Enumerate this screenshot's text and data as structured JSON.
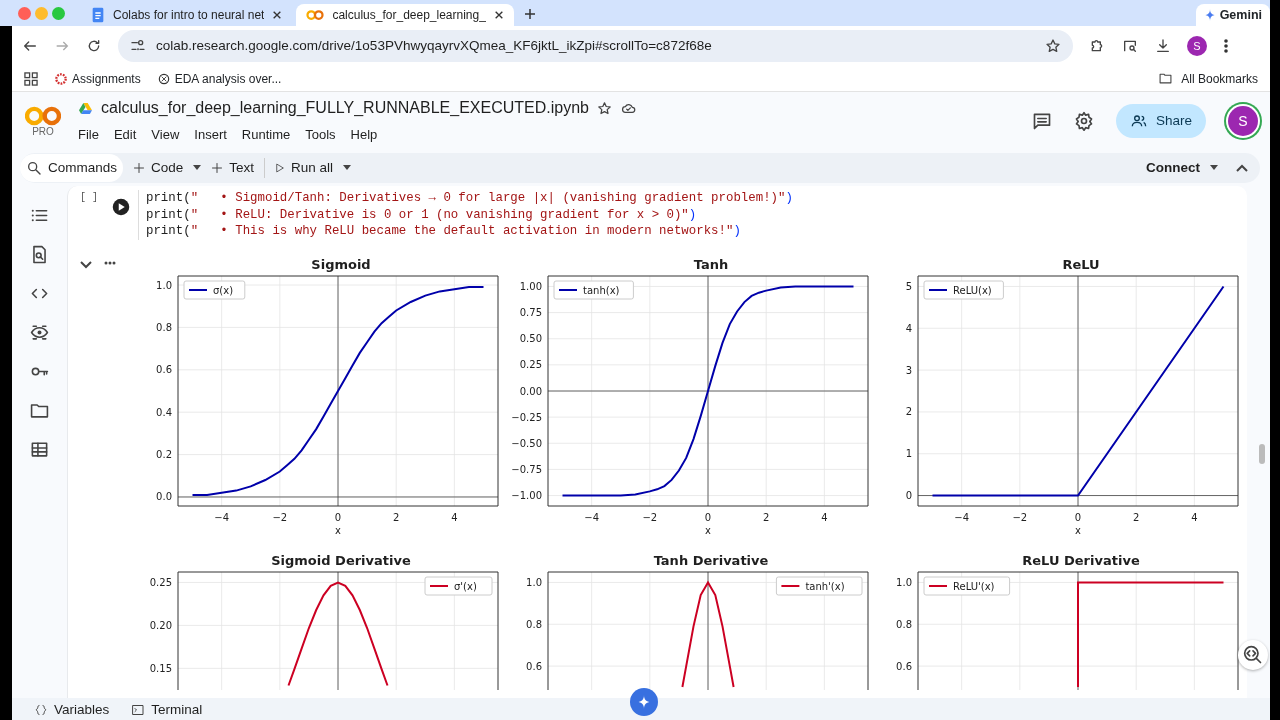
{
  "browser": {
    "tabs": [
      {
        "title": "Colabs for intro to neural net",
        "kind": "doc",
        "selected": false
      },
      {
        "title": "calculus_for_deep_learning_",
        "kind": "colab",
        "selected": true
      }
    ],
    "gemini": "Gemini",
    "address": "colab.research.google.com/drive/1o53PVhwyqayrvXQmea_KF6jktL_ikZpi#scrollTo=c872f68e",
    "profile": "S",
    "bookmarks": [
      {
        "label": "Assignments",
        "kind": "canvas"
      },
      {
        "label": "EDA analysis over...",
        "kind": "chat"
      }
    ],
    "all_bookmarks": "All Bookmarks"
  },
  "colab": {
    "plan": "PRO",
    "title": "calculus_for_deep_learning_FULLY_RUNNABLE_EXECUTED.ipynb",
    "menu": [
      "File",
      "Edit",
      "View",
      "Insert",
      "Runtime",
      "Tools",
      "Help"
    ],
    "share": "Share",
    "avatar": "S",
    "toolbar": {
      "commands": "Commands",
      "code": "Code",
      "text": "Text",
      "run_all": "Run all",
      "connect": "Connect"
    }
  },
  "cell": {
    "bracket": "[ ]",
    "code_lines": [
      "print(\"   • Sigmoid/Tanh: Derivatives → 0 for large |x| (vanishing gradient problem!)\")",
      "print(\"   • ReLU: Derivative is 0 or 1 (no vanishing gradient for x > 0)\")",
      "print(\"   • This is why ReLU became the default activation in modern networks!\")"
    ]
  },
  "plot_rows": [
    [
      {
        "chart_data": {
          "type": "line",
          "title": "Sigmoid",
          "xlabel": "x",
          "grid": true,
          "x": [
            -5,
            -4.5,
            -4,
            -3.5,
            -3,
            -2.5,
            -2,
            -1.75,
            -1.5,
            -1.25,
            -1,
            -0.75,
            -0.5,
            -0.25,
            0,
            0.25,
            0.5,
            0.75,
            1,
            1.25,
            1.5,
            1.75,
            2,
            2.5,
            3,
            3.5,
            4,
            4.5,
            5
          ],
          "xlim": [
            -5.5,
            5.5
          ],
          "ylim": [
            -0.0426,
            1.0426
          ],
          "xticks": [
            {
              "value": -4,
              "label": "−4"
            },
            {
              "value": -2,
              "label": "−2"
            },
            {
              "value": 0,
              "label": "0"
            },
            {
              "value": 2,
              "label": "2"
            },
            {
              "value": 4,
              "label": "4"
            }
          ],
          "yticks": [
            {
              "value": 0,
              "label": "0.0"
            },
            {
              "value": 0.2,
              "label": "0.2"
            },
            {
              "value": 0.4,
              "label": "0.4"
            },
            {
              "value": 0.6,
              "label": "0.6"
            },
            {
              "value": 0.8,
              "label": "0.8"
            },
            {
              "value": 1,
              "label": "1.0"
            }
          ],
          "series": [
            {
              "name": "σ(x)",
              "color": "#0000aa",
              "values": [
                0.01,
                0.01,
                0.02,
                0.03,
                0.05,
                0.08,
                0.12,
                0.15,
                0.18,
                0.22,
                0.27,
                0.32,
                0.38,
                0.44,
                0.5,
                0.56,
                0.62,
                0.68,
                0.73,
                0.78,
                0.82,
                0.85,
                0.88,
                0.92,
                0.95,
                0.97,
                0.98,
                0.99,
                0.99
              ]
            }
          ]
        }
      },
      {
        "chart_data": {
          "type": "line",
          "title": "Tanh",
          "xlabel": "x",
          "grid": true,
          "x": [
            -5,
            -4.5,
            -4,
            -3.5,
            -3,
            -2.5,
            -2,
            -1.75,
            -1.5,
            -1.25,
            -1,
            -0.75,
            -0.5,
            -0.25,
            0,
            0.25,
            0.5,
            0.75,
            1,
            1.25,
            1.5,
            1.75,
            2,
            2.5,
            3,
            3.5,
            4,
            4.5,
            5
          ],
          "xlim": [
            -5.5,
            5.5
          ],
          "ylim": [
            -1.1,
            1.1
          ],
          "xticks": [
            {
              "value": -4,
              "label": "−4"
            },
            {
              "value": -2,
              "label": "−2"
            },
            {
              "value": 0,
              "label": "0"
            },
            {
              "value": 2,
              "label": "2"
            },
            {
              "value": 4,
              "label": "4"
            }
          ],
          "yticks": [
            {
              "value": -1,
              "label": "−1.00"
            },
            {
              "value": -0.75,
              "label": "−0.75"
            },
            {
              "value": -0.5,
              "label": "−0.50"
            },
            {
              "value": -0.25,
              "label": "−0.25"
            },
            {
              "value": 0,
              "label": "0.00"
            },
            {
              "value": 0.25,
              "label": "0.25"
            },
            {
              "value": 0.5,
              "label": "0.50"
            },
            {
              "value": 0.75,
              "label": "0.75"
            },
            {
              "value": 1,
              "label": "1.00"
            }
          ],
          "series": [
            {
              "name": "tanh(x)",
              "color": "#0000aa",
              "values": [
                -1,
                -1,
                -1,
                -1,
                -1,
                -0.99,
                -0.96,
                -0.94,
                -0.91,
                -0.85,
                -0.76,
                -0.64,
                -0.46,
                -0.24,
                0,
                0.24,
                0.46,
                0.64,
                0.76,
                0.85,
                0.91,
                0.94,
                0.96,
                0.99,
                1,
                1,
                1,
                1,
                1
              ]
            }
          ]
        }
      },
      {
        "chart_data": {
          "type": "line",
          "title": "ReLU",
          "xlabel": "x",
          "grid": true,
          "x": [
            -5,
            0,
            5
          ],
          "xlim": [
            -5.5,
            5.5
          ],
          "ylim": [
            -0.25,
            5.25
          ],
          "xticks": [
            {
              "value": -4,
              "label": "−4"
            },
            {
              "value": -2,
              "label": "−2"
            },
            {
              "value": 0,
              "label": "0"
            },
            {
              "value": 2,
              "label": "2"
            },
            {
              "value": 4,
              "label": "4"
            }
          ],
          "yticks": [
            0,
            1,
            2,
            3,
            4,
            5
          ],
          "series": [
            {
              "name": "ReLU(x)",
              "color": "#0000aa",
              "values": [
                0,
                0,
                5
              ]
            }
          ]
        }
      }
    ],
    [
      {
        "chart_data": {
          "type": "line",
          "title": "Sigmoid Derivative",
          "grid": true,
          "x": [
            -1.7,
            -1.5,
            -1.25,
            -1,
            -0.75,
            -0.5,
            -0.25,
            0,
            0.25,
            0.5,
            0.75,
            1,
            1.25,
            1.5,
            1.7
          ],
          "xlim": [
            -5.5,
            5.5
          ],
          "ylim": [
            -0.0056,
            0.2622
          ],
          "yticks": [
            {
              "value": 0.15,
              "label": "0.15"
            },
            {
              "value": 0.2,
              "label": "0.20"
            },
            {
              "value": 0.25,
              "label": "0.25"
            }
          ],
          "series": [
            {
              "name": "σ'(x)",
              "color": "#cc0022",
              "values": [
                0.13,
                0.149,
                0.173,
                0.197,
                0.218,
                0.235,
                0.246,
                0.25,
                0.246,
                0.235,
                0.218,
                0.197,
                0.173,
                0.149,
                0.13
              ]
            }
          ]
        }
      },
      {
        "chart_data": {
          "type": "line",
          "title": "Tanh Derivative",
          "grid": true,
          "x": [
            -0.88,
            -0.75,
            -0.5,
            -0.25,
            0,
            0.25,
            0.5,
            0.75,
            0.88
          ],
          "xlim": [
            -5.5,
            5.5
          ],
          "ylim": [
            -0.05,
            1.05
          ],
          "yticks": [
            {
              "value": 0.6,
              "label": "0.6"
            },
            {
              "value": 0.8,
              "label": "0.8"
            },
            {
              "value": 1,
              "label": "1.0"
            }
          ],
          "series": [
            {
              "name": "tanh'(x)",
              "color": "#cc0022",
              "values": [
                0.5,
                0.6,
                0.79,
                0.94,
                1,
                0.94,
                0.79,
                0.6,
                0.5
              ]
            }
          ]
        }
      },
      {
        "chart_data": {
          "type": "line",
          "title": "ReLU Derivative",
          "grid": true,
          "x": [
            0,
            0,
            5
          ],
          "xlim": [
            -5.5,
            5.5
          ],
          "ylim": [
            -0.05,
            1.05
          ],
          "yticks": [
            {
              "value": 0.6,
              "label": "0.6"
            },
            {
              "value": 0.8,
              "label": "0.8"
            },
            {
              "value": 1,
              "label": "1.0"
            }
          ],
          "series": [
            {
              "name": "ReLU'(x)",
              "color": "#cc0022",
              "values": [
                0.5,
                1,
                1
              ]
            }
          ]
        }
      }
    ]
  ],
  "bottom": {
    "variables": "Variables",
    "terminal": "Terminal"
  }
}
